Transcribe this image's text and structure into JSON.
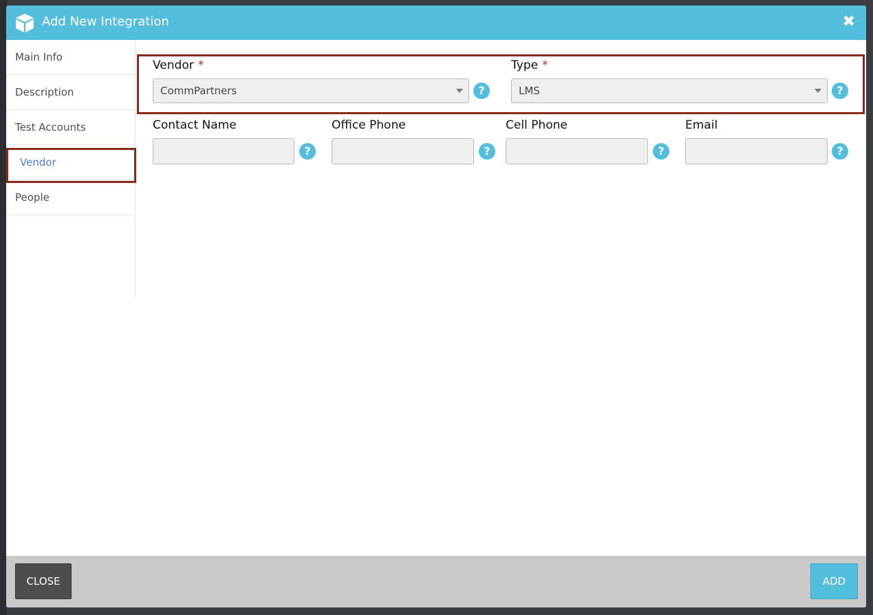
{
  "modal": {
    "title": "Add New Integration",
    "close_icon": "close-icon",
    "header_icon": "cube-icon"
  },
  "sidebar": {
    "items": [
      {
        "label": "Main Info"
      },
      {
        "label": "Description"
      },
      {
        "label": "Test Accounts"
      },
      {
        "label": "Vendor",
        "active": true
      },
      {
        "label": "People"
      }
    ]
  },
  "form": {
    "vendor": {
      "label": "Vendor",
      "required_mark": "*",
      "value": "CommPartners"
    },
    "type": {
      "label": "Type",
      "required_mark": "*",
      "value": "LMS"
    },
    "contact_name": {
      "label": "Contact Name",
      "value": ""
    },
    "office_phone": {
      "label": "Office Phone",
      "value": ""
    },
    "cell_phone": {
      "label": "Cell Phone",
      "value": ""
    },
    "email": {
      "label": "Email",
      "value": ""
    },
    "help_glyph": "?"
  },
  "footer": {
    "close_label": "CLOSE",
    "add_label": "ADD"
  },
  "colors": {
    "header": "#52bedb",
    "accent_active": "#4f7ee8",
    "highlight_border": "#8a2a1d",
    "required": "#a83228"
  }
}
